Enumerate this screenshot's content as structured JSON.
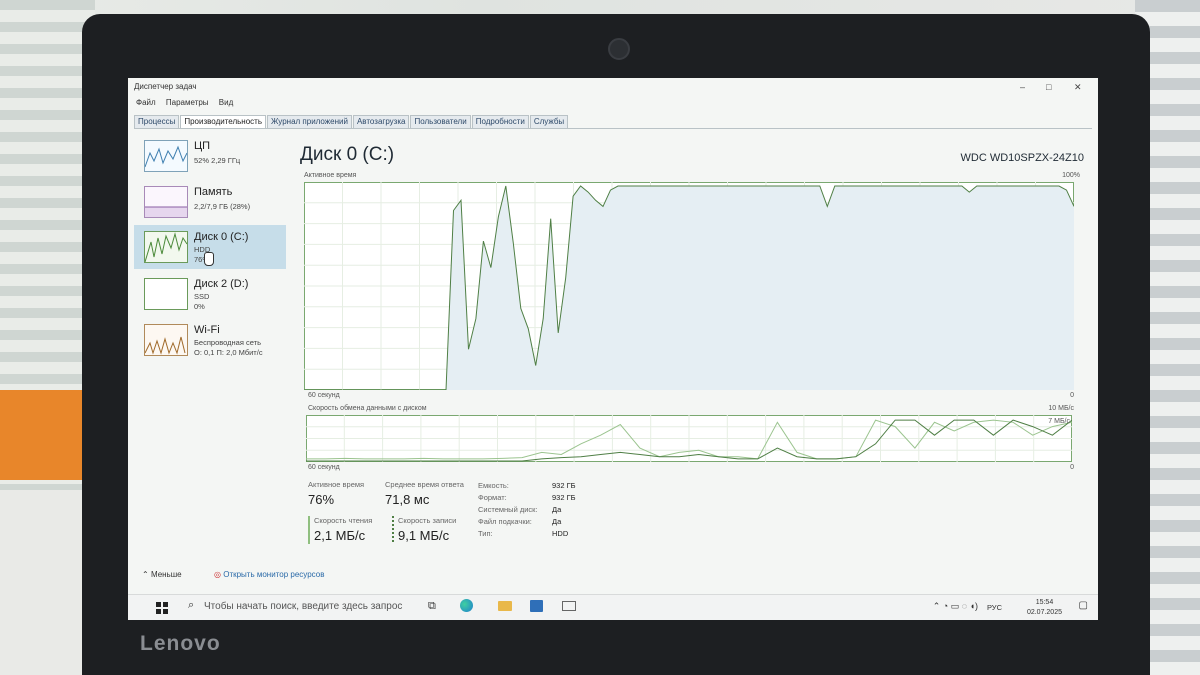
{
  "window": {
    "title": "Диспетчер задач",
    "controls": [
      "–",
      "□",
      "✕"
    ]
  },
  "menu": [
    "Файл",
    "Параметры",
    "Вид"
  ],
  "tabs": [
    "Процессы",
    "Производительность",
    "Журнал приложений",
    "Автозагрузка",
    "Пользователи",
    "Подробности",
    "Службы"
  ],
  "active_tab": "Производительность",
  "sidebar": [
    {
      "name": "ЦП",
      "sub1": "52% 2,29 ГГц",
      "sub2": ""
    },
    {
      "name": "Память",
      "sub1": "2,2/7,9 ГБ (28%)",
      "sub2": ""
    },
    {
      "name": "Диск 0 (C:)",
      "sub1": "HDD",
      "sub2": "76%"
    },
    {
      "name": "Диск 2 (D:)",
      "sub1": "SSD",
      "sub2": "0%"
    },
    {
      "name": "Wi-Fi",
      "sub1": "Беспроводная сеть",
      "sub2": "О: 0,1 П: 2,0 Мбит/с"
    }
  ],
  "main": {
    "title": "Диск 0 (C:)",
    "model": "WDC WD10SPZX-24Z10",
    "active_time_label": "Активное время",
    "active_time_max": "100%",
    "x_left": "60 секунд",
    "x_right": "0",
    "transfer_label": "Скорость обмена данными с диском",
    "transfer_max": "10 МБ/с",
    "transfer_mark": "7 МБ/с"
  },
  "stats": {
    "active_time_label": "Активное время",
    "active_time": "76%",
    "avg_response_label": "Среднее время ответа",
    "avg_response": "71,8 мс",
    "read_label": "Скорость чтения",
    "read": "2,1 МБ/с",
    "write_label": "Скорость записи",
    "write": "9,1 МБ/с",
    "props": [
      {
        "k": "Емкость:",
        "v": "932 ГБ"
      },
      {
        "k": "Формат:",
        "v": "932 ГБ"
      },
      {
        "k": "Системный диск:",
        "v": "Да"
      },
      {
        "k": "Файл подкачки:",
        "v": "Да"
      },
      {
        "k": "Тип:",
        "v": "HDD"
      }
    ]
  },
  "footer": {
    "fewer": "Меньше",
    "resmon": "Открыть монитор ресурсов"
  },
  "taskbar": {
    "search": "Чтобы начать поиск, введите здесь запрос",
    "lang": "РУС",
    "time": "15:54",
    "date": "02.07.2025"
  },
  "laptop": {
    "brand": "Lenovo"
  },
  "graph": {
    "active_time": [
      0,
      0,
      0,
      0,
      0,
      0,
      0,
      0,
      0,
      0,
      0,
      0,
      0,
      0,
      0,
      0,
      0,
      0,
      0,
      0,
      88,
      93,
      20,
      35,
      73,
      60,
      85,
      100,
      72,
      40,
      30,
      12,
      35,
      84,
      28,
      55,
      95,
      100,
      97,
      93,
      90,
      98,
      100,
      100,
      100,
      100,
      100,
      100,
      100,
      100,
      100,
      100,
      100,
      100,
      100,
      100,
      100,
      100,
      100,
      100,
      100,
      100,
      100,
      100,
      100,
      100,
      100,
      100,
      100,
      100,
      90,
      100,
      100,
      100,
      100,
      100,
      100,
      100,
      100,
      100,
      100,
      100,
      100,
      100,
      100,
      100,
      100,
      100,
      100,
      97,
      100,
      100,
      100,
      100,
      100,
      100,
      100,
      100,
      100,
      100,
      100,
      100,
      98,
      90
    ],
    "transfer_read": [
      5,
      5,
      6,
      5,
      5,
      5,
      6,
      5,
      5,
      5,
      6,
      8,
      20,
      15,
      40,
      60,
      85,
      30,
      10,
      20,
      25,
      10,
      10,
      5,
      90,
      20,
      5,
      5,
      10,
      95,
      80,
      30,
      90,
      70,
      90,
      95,
      90,
      60,
      80,
      90
    ],
    "transfer_write": [
      0,
      0,
      0,
      0,
      0,
      0,
      0,
      0,
      0,
      0,
      0,
      0,
      5,
      8,
      10,
      15,
      20,
      15,
      10,
      10,
      15,
      10,
      5,
      5,
      30,
      10,
      5,
      5,
      10,
      40,
      95,
      95,
      60,
      95,
      95,
      60,
      95,
      80,
      60,
      95
    ]
  }
}
